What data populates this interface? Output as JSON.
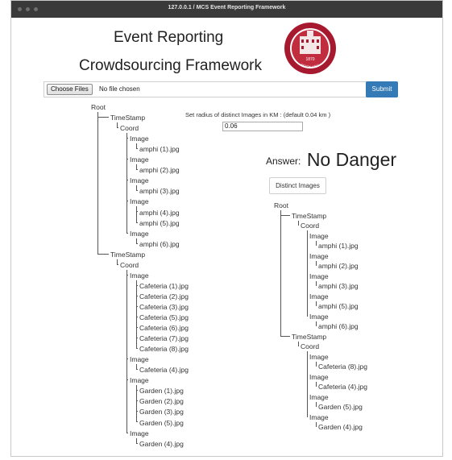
{
  "window": {
    "title": "127.0.0.1 / MCS Event Reporting Framework"
  },
  "header": {
    "title_line1": "Event Reporting",
    "title_line2": "Crowdsourcing Framework",
    "seal_year": "1870",
    "seal_text": "SETON HALL"
  },
  "upload": {
    "choose_label": "Choose Files",
    "no_file_text": "No file chosen",
    "submit_label": "Submit"
  },
  "radius": {
    "label": "Set radius of distinct Images in KM : (default 0.04 km )",
    "value": "0.06"
  },
  "answer": {
    "label": "Answer:",
    "value": "No Danger"
  },
  "distinct_button": {
    "label": "Distinct Images"
  },
  "left_tree": [
    "Root",
    "TimeStamp",
    "Coord",
    "Image",
    "amphi (1).jpg",
    "Image",
    "amphi (2).jpg",
    "Image",
    "amphi (3).jpg",
    "Image",
    "amphi (4).jpg",
    "amphi (5).jpg",
    "Image",
    "amphi (6).jpg",
    "TimeStamp",
    "Coord",
    "Image",
    "Cafeteria (1).jpg",
    "Cafeteria (2).jpg",
    "Cafeteria (3).jpg",
    "Cafeteria (5).jpg",
    "Cafeteria (6).jpg",
    "Cafeteria (7).jpg",
    "Cafeteria (8).jpg",
    "Image",
    "Cafeteria (4).jpg",
    "Image",
    "Garden (1).jpg",
    "Garden (2).jpg",
    "Garden (3).jpg",
    "Garden (5).jpg",
    "Image",
    "Garden (4).jpg"
  ],
  "right_tree": [
    "Root",
    "TimeStamp",
    "Coord",
    "Image",
    "amphi (1).jpg",
    "Image",
    "amphi (2).jpg",
    "Image",
    "amphi (3).jpg",
    "Image",
    "amphi (5).jpg",
    "Image",
    "amphi (6).jpg",
    "TimeStamp",
    "Coord",
    "Image",
    "Cafeteria (8).jpg",
    "Image",
    "Cafeteria (4).jpg",
    "Image",
    "Garden (5).jpg",
    "Image",
    "Garden (4).jpg"
  ]
}
